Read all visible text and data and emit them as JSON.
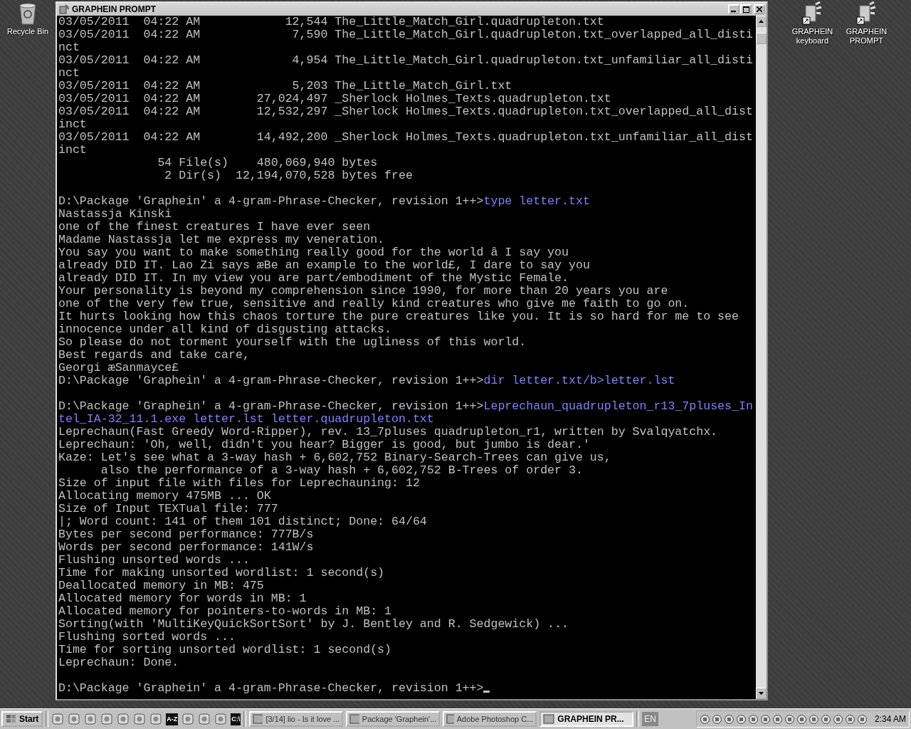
{
  "desktop_icons_left": [
    {
      "label": "Recycle Bin"
    }
  ],
  "desktop_icons_right": [
    {
      "label": "GRAPHEIN keyboard"
    },
    {
      "label": "GRAPHEIN PROMPT"
    }
  ],
  "window": {
    "title": "GRAPHEIN PROMPT",
    "lines": [
      {
        "kind": "out",
        "text": "03/05/2011  04:22 AM            12,544 The_Little_Match_Girl.quadrupleton.txt"
      },
      {
        "kind": "out",
        "text": "03/05/2011  04:22 AM             7,590 The_Little_Match_Girl.quadrupleton.txt_overlapped_all_disti"
      },
      {
        "kind": "out",
        "text": "nct"
      },
      {
        "kind": "out",
        "text": "03/05/2011  04:22 AM             4,954 The_Little_Match_Girl.quadrupleton.txt_unfamiliar_all_disti"
      },
      {
        "kind": "out",
        "text": "nct"
      },
      {
        "kind": "out",
        "text": "03/05/2011  04:22 AM             5,203 The_Little_Match_Girl.txt"
      },
      {
        "kind": "out",
        "text": "03/05/2011  04:22 AM        27,024,497 _Sherlock Holmes_Texts.quadrupleton.txt"
      },
      {
        "kind": "out",
        "text": "03/05/2011  04:22 AM        12,532,297 _Sherlock Holmes_Texts.quadrupleton.txt_overlapped_all_dist"
      },
      {
        "kind": "out",
        "text": "inct"
      },
      {
        "kind": "out",
        "text": "03/05/2011  04:22 AM        14,492,200 _Sherlock Holmes_Texts.quadrupleton.txt_unfamiliar_all_dist"
      },
      {
        "kind": "out",
        "text": "inct"
      },
      {
        "kind": "out",
        "text": "              54 File(s)    480,069,940 bytes"
      },
      {
        "kind": "out",
        "text": "               2 Dir(s)  12,194,070,528 bytes free"
      },
      {
        "kind": "blank"
      },
      {
        "kind": "prompt",
        "text": "D:\\Package 'Graphein' a 4-gram-Phrase-Checker, revision 1++>",
        "command": "type letter.txt"
      },
      {
        "kind": "out",
        "text": "Nastassja Kinski"
      },
      {
        "kind": "out",
        "text": "one of the finest creatures I have ever seen"
      },
      {
        "kind": "out",
        "text": "Madame Nastassja let me express my veneration."
      },
      {
        "kind": "out",
        "text": "You say you want to make something really good for the world â I say you"
      },
      {
        "kind": "out",
        "text": "already DID IT. Lao Zi says æBe an example to the world£, I dare to say you"
      },
      {
        "kind": "out",
        "text": "already DID IT. In my view you are part/embodiment of the Mystic Female."
      },
      {
        "kind": "out",
        "text": "Your personality is beyond my comprehension since 1990, for more than 20 years you are"
      },
      {
        "kind": "out",
        "text": "one of the very few true, sensitive and really kind creatures who give me faith to go on."
      },
      {
        "kind": "out",
        "text": "It hurts looking how this chaos torture the pure creatures like you. It is so hard for me to see"
      },
      {
        "kind": "out",
        "text": "innocence under all kind of disgusting attacks."
      },
      {
        "kind": "out",
        "text": "So please do not torment yourself with the ugliness of this world."
      },
      {
        "kind": "out",
        "text": "Best regards and take care,"
      },
      {
        "kind": "out",
        "text": "Georgi æSanmayce£"
      },
      {
        "kind": "prompt",
        "text": "D:\\Package 'Graphein' a 4-gram-Phrase-Checker, revision 1++>",
        "command": "dir letter.txt/b>letter.lst"
      },
      {
        "kind": "blank"
      },
      {
        "kind": "prompt",
        "text": "D:\\Package 'Graphein' a 4-gram-Phrase-Checker, revision 1++>",
        "command": "Leprechaun_quadrupleton_r13_7pluses_In"
      },
      {
        "kind": "command",
        "command": "tel_IA-32_11.1.exe letter.lst letter.quadrupleton.txt"
      },
      {
        "kind": "out",
        "text": "Leprechaun(Fast Greedy Word-Ripper), rev. 13_7pluses quadrupleton_r1, written by Svalqyatchx."
      },
      {
        "kind": "out",
        "text": "Leprechaun: 'Oh, well, didn't you hear? Bigger is good, but jumbo is dear.'"
      },
      {
        "kind": "out",
        "text": "Kaze: Let's see what a 3-way hash + 6,602,752 Binary-Search-Trees can give us,"
      },
      {
        "kind": "out",
        "text": "      also the performance of a 3-way hash + 6,602,752 B-Trees of order 3."
      },
      {
        "kind": "out",
        "text": "Size of input file with files for Leprechauning: 12"
      },
      {
        "kind": "out",
        "text": "Allocating memory 475MB ... OK"
      },
      {
        "kind": "out",
        "text": "Size of Input TEXTual file: 777"
      },
      {
        "kind": "out",
        "text": "|; Word count: 141 of them 101 distinct; Done: 64/64"
      },
      {
        "kind": "out",
        "text": "Bytes per second performance: 777B/s"
      },
      {
        "kind": "out",
        "text": "Words per second performance: 141W/s"
      },
      {
        "kind": "out",
        "text": "Flushing unsorted words ..."
      },
      {
        "kind": "out",
        "text": "Time for making unsorted wordlist: 1 second(s)"
      },
      {
        "kind": "out",
        "text": "Deallocated memory in MB: 475"
      },
      {
        "kind": "out",
        "text": "Allocated memory for words in MB: 1"
      },
      {
        "kind": "out",
        "text": "Allocated memory for pointers-to-words in MB: 1"
      },
      {
        "kind": "out",
        "text": "Sorting(with 'MultiKeyQuickSortSort' by J. Bentley and R. Sedgewick) ..."
      },
      {
        "kind": "out",
        "text": "Flushing sorted words ..."
      },
      {
        "kind": "out",
        "text": "Time for sorting unsorted wordlist: 1 second(s)"
      },
      {
        "kind": "out",
        "text": "Leprechaun: Done."
      },
      {
        "kind": "blank"
      },
      {
        "kind": "prompt",
        "text": "D:\\Package 'Graphein' a 4-gram-Phrase-Checker, revision 1++>",
        "cursor": true
      }
    ]
  },
  "taskbar": {
    "start": "Start",
    "quick_launch": [
      {
        "kind": "app"
      },
      {
        "kind": "app"
      },
      {
        "kind": "app"
      },
      {
        "kind": "app"
      },
      {
        "kind": "app"
      },
      {
        "kind": "app"
      },
      {
        "kind": "app"
      },
      {
        "kind": "text",
        "label": "A-Z"
      },
      {
        "kind": "app"
      },
      {
        "kind": "app"
      },
      {
        "kind": "app"
      },
      {
        "kind": "text",
        "label": "C:\\"
      }
    ],
    "tasks": [
      {
        "label": "[3/14] lio - Is it love ...",
        "selected": false
      },
      {
        "label": "Package 'Graphein'...",
        "selected": false
      },
      {
        "label": "Adobe Photoshop C...",
        "selected": false
      },
      {
        "label": "GRAPHEIN PR...",
        "selected": true
      }
    ],
    "language": "EN",
    "clock": "2:34 AM"
  }
}
